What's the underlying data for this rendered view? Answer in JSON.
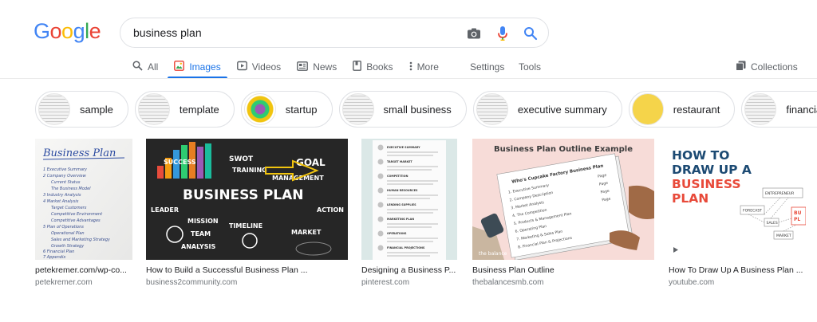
{
  "logo": {
    "g1": "G",
    "o1": "o",
    "o2": "o",
    "g2": "g",
    "l": "l",
    "e": "e"
  },
  "search": {
    "query": "business plan"
  },
  "tabs": [
    {
      "label": "All",
      "icon": "search-icon"
    },
    {
      "label": "Images",
      "icon": "image-icon"
    },
    {
      "label": "Videos",
      "icon": "video-icon"
    },
    {
      "label": "News",
      "icon": "news-icon"
    },
    {
      "label": "Books",
      "icon": "book-icon"
    },
    {
      "label": "More",
      "icon": "more-vertical-icon"
    }
  ],
  "settings_label": "Settings",
  "tools_label": "Tools",
  "collections_label": "Collections",
  "chips": [
    {
      "label": "sample"
    },
    {
      "label": "template"
    },
    {
      "label": "startup"
    },
    {
      "label": "small business"
    },
    {
      "label": "executive summary"
    },
    {
      "label": "restaurant"
    },
    {
      "label": "financial"
    }
  ],
  "results": [
    {
      "title": "petekremer.com/wp-co...",
      "source": "petekremer.com",
      "image_text": {
        "heading": "Business Plan",
        "lines": [
          "1 Executive Summary",
          "2 Company Overview",
          "Current Status",
          "The Business Model",
          "3 Industry Analysis",
          "4 Market Analysis",
          "Target Customers",
          "Competitive Environment",
          "Competitive Advantages",
          "5 Plan of Operations",
          "Operational Plan",
          "Sales and Marketing Strategy",
          "Growth Strategy",
          "6 Financial Plan",
          "7 Appendix"
        ]
      }
    },
    {
      "title": "How to Build a Successful Business Plan ...",
      "source": "business2community.com",
      "image_text": {
        "main": "BUSINESS PLAN",
        "words": [
          "SUCCESS",
          "SWOT",
          "TRAINING",
          "GOAL",
          "MANAGEMENT",
          "LEADER",
          "MISSION",
          "TEAM",
          "ANALYSIS",
          "TIMELINE",
          "MARKET",
          "ACTION"
        ]
      }
    },
    {
      "title": "Designing a Business P...",
      "source": "pinterest.com",
      "image_text": {
        "sections": [
          "EXECUTIVE SUMMARY",
          "TARGET MARKET",
          "COMPETITION",
          "HUMAN RESOURCES",
          "LENDING SUPPLIES",
          "MARKETING PLAN",
          "OPERATIONS",
          "FINANCIAL PROJECTIONS"
        ]
      }
    },
    {
      "title": "Business Plan Outline",
      "source": "thebalancesmb.com",
      "image_text": {
        "heading": "Business Plan Outline Example",
        "doc_title": "Who's Cupcake Factory Business Plan",
        "lines": [
          "1. Executive Summary",
          "2. Company Description",
          "3. Market Analysis",
          "4. The Competition",
          "5. Products & Management Plan",
          "6. Operating Plan",
          "7. Marketing & Sales Plan",
          "8. Financial Plan & Projections"
        ],
        "page_label": "Page",
        "brand": "the balance"
      }
    },
    {
      "title": "How To Draw Up A Business Plan ...",
      "source": "youtube.com",
      "image_text": {
        "line1": "HOW TO",
        "line2": "DRAW UP A",
        "line3": "BUSINESS",
        "line4": "PLAN",
        "tags": [
          "ENTREPRENEUR",
          "FORECAST",
          "SALES",
          "MARKET",
          "BU",
          "PL"
        ]
      }
    }
  ],
  "colors": {
    "accent": "#1a73e8",
    "blue": "#4285f4",
    "red": "#ea4335",
    "yellow": "#fbbc05",
    "green": "#34a853"
  }
}
